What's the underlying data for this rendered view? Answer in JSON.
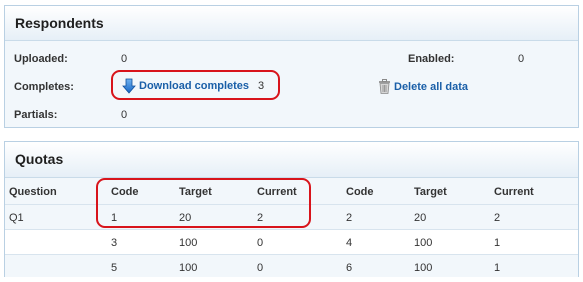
{
  "respondents": {
    "title": "Respondents",
    "uploaded_label": "Uploaded:",
    "uploaded_value": "0",
    "enabled_label": "Enabled:",
    "enabled_value": "0",
    "completes_label": "Completes:",
    "download_label": "Download completes",
    "completes_count": "3",
    "delete_label": "Delete all data",
    "partials_label": "Partials:",
    "partials_value": "0"
  },
  "quotas": {
    "title": "Quotas",
    "headers": [
      "Question",
      "Code",
      "Target",
      "Current",
      "Code",
      "Target",
      "Current"
    ],
    "rows": [
      [
        "Q1",
        "1",
        "20",
        "2",
        "2",
        "20",
        "2"
      ],
      [
        "",
        "3",
        "100",
        "0",
        "4",
        "100",
        "1"
      ],
      [
        "",
        "5",
        "100",
        "0",
        "6",
        "100",
        "1"
      ]
    ]
  },
  "colors": {
    "link": "#1a5fa8",
    "highlight": "#d8141b",
    "panel_border": "#b9d0e3"
  },
  "icons": {
    "download": "download-arrow-icon",
    "delete": "trash-icon"
  }
}
